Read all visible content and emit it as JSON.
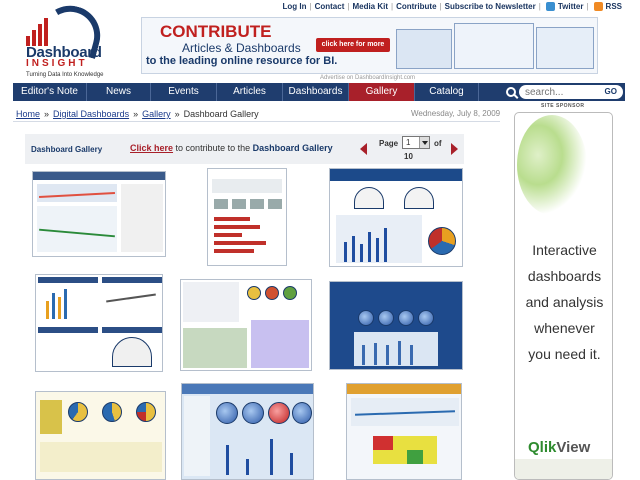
{
  "top_links": {
    "login": "Log In",
    "contact": "Contact",
    "media_kit": "Media Kit",
    "contribute": "Contribute",
    "newsletter": "Subscribe to Newsletter",
    "twitter": "Twitter",
    "rss": "RSS"
  },
  "logo": {
    "name": "Dashboard",
    "sub": "INSIGHT",
    "tagline": "Turning Data Into Knowledge"
  },
  "banner": {
    "title": "CONTRIBUTE",
    "line1": "Articles & Dashboards",
    "line2": "to the leading online resource for BI.",
    "button": "click here for more",
    "advertise": "Advertise on DashboardInsight.com"
  },
  "nav": {
    "items": [
      "Editor's Note",
      "News",
      "Events",
      "Articles",
      "Dashboards",
      "Gallery",
      "Catalog"
    ],
    "active": "Gallery",
    "search_placeholder": "search...",
    "search_go": "GO"
  },
  "breadcrumb": {
    "home": "Home",
    "digital": "Digital Dashboards",
    "gallery": "Gallery",
    "current": "Dashboard Gallery",
    "sep": "»",
    "date": "Wednesday, July 8, 2009"
  },
  "gallery": {
    "title": "Dashboard Gallery",
    "click_here": "Click here",
    "contribute_text": "to contribute to the",
    "contribute_target": "Dashboard Gallery",
    "page_label": "Page",
    "page_value": "1",
    "page_of": "of",
    "page_total": "10"
  },
  "side_ad": {
    "sponsored": "SITE SPONSOR",
    "line1": "Interactive",
    "line2": "dashboards",
    "line3": "and analysis",
    "line4": "whenever",
    "line5": "you need it.",
    "brand_q": "Qlik",
    "brand_rest": "View"
  },
  "colors": {
    "nav_bg": "#1f3d6e",
    "nav_active": "#a8202a",
    "brand_red": "#c0201f",
    "brand_blue": "#1a3a6a"
  }
}
